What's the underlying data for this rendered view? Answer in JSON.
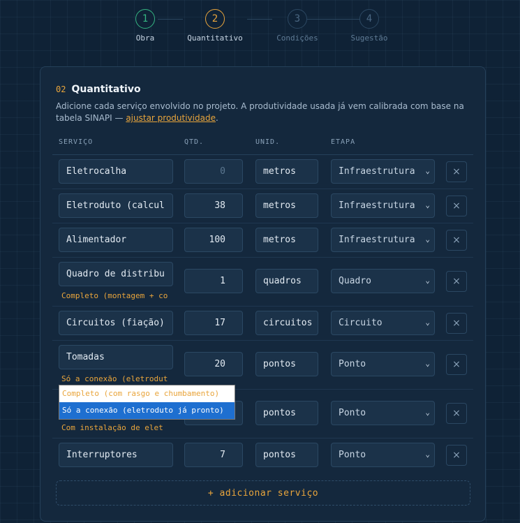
{
  "stepper": {
    "steps": [
      {
        "number": "1",
        "label": "Obra",
        "state": "done"
      },
      {
        "number": "2",
        "label": "Quantitativo",
        "state": "active"
      },
      {
        "number": "3",
        "label": "Condições",
        "state": "pending"
      },
      {
        "number": "4",
        "label": "Sugestão",
        "state": "pending"
      }
    ]
  },
  "card": {
    "step_number": "02",
    "title": "Quantitativo",
    "description": "Adicione cada serviço envolvido no projeto. A produtividade usada já vem calibrada com base na tabela SINAPI — ",
    "link_text": "ajustar produtividade",
    "description_end": "."
  },
  "table": {
    "headers": {
      "servico": "SERVIÇO",
      "qtd": "QTD.",
      "unid": "UNID.",
      "etapa": "ETAPA"
    },
    "rows": [
      {
        "servico": "Eletrocalha",
        "qtd": "0",
        "unid": "metros",
        "etapa": "Infraestrutura",
        "subselect": ""
      },
      {
        "servico": "Eletroduto (calcul",
        "qtd": "38",
        "unid": "metros",
        "etapa": "Infraestrutura",
        "subselect": ""
      },
      {
        "servico": "Alimentador",
        "qtd": "100",
        "unid": "metros",
        "etapa": "Infraestrutura",
        "subselect": ""
      },
      {
        "servico": "Quadro de distribu",
        "qtd": "1",
        "unid": "quadros",
        "etapa": "Quadro",
        "subselect": "Completo (montagem + co"
      },
      {
        "servico": "Circuitos (fiação)",
        "qtd": "17",
        "unid": "circuitos",
        "etapa": "Circuito",
        "subselect": ""
      },
      {
        "servico": "Tomadas",
        "qtd": "20",
        "unid": "pontos",
        "etapa": "Ponto",
        "subselect": "Só a conexão (eletrodut"
      },
      {
        "servico": "",
        "qtd": "",
        "unid": "pontos",
        "etapa": "Ponto",
        "subselect": "Com instalação de elet"
      },
      {
        "servico": "Interruptores",
        "qtd": "7",
        "unid": "pontos",
        "etapa": "Ponto",
        "subselect": ""
      }
    ],
    "remove_label": "×"
  },
  "dropdown_popup": {
    "options": [
      "Completo (com rasgo e chumbamento)",
      "Só a conexão (eletroduto já pronto)"
    ],
    "selected_index": 1
  },
  "add_button": "+ adicionar serviço",
  "colors": {
    "accent": "#e9a53c",
    "done": "#35b582",
    "selected": "#1e6fd0"
  },
  "icons": {
    "remove": "close-icon",
    "select": "chevron-down-icon"
  }
}
